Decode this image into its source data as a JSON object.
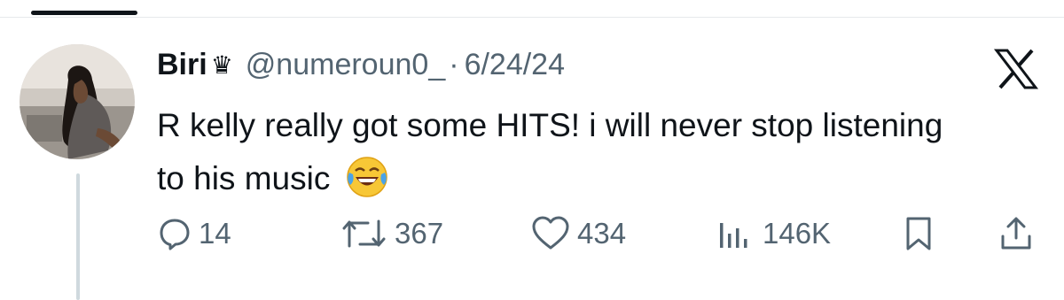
{
  "tweet": {
    "display_name": "Biri",
    "name_badge": "♛",
    "handle": "@numeroun0_",
    "separator": "·",
    "date": "6/24/24",
    "text": "R kelly really got some HITS! i will never stop listening to his music",
    "emoji": "face-with-tears-of-joy"
  },
  "stats": {
    "replies": "14",
    "reposts": "367",
    "likes": "434",
    "views": "146K"
  },
  "icons": {
    "reply": "reply-icon",
    "repost": "repost-icon",
    "like": "heart-icon",
    "views": "views-icon",
    "bookmark": "bookmark-icon",
    "share": "share-icon",
    "logo": "x-logo-icon"
  },
  "colors": {
    "text": "#0f1419",
    "secondary": "#536471",
    "thread_line": "#cfd9de"
  }
}
